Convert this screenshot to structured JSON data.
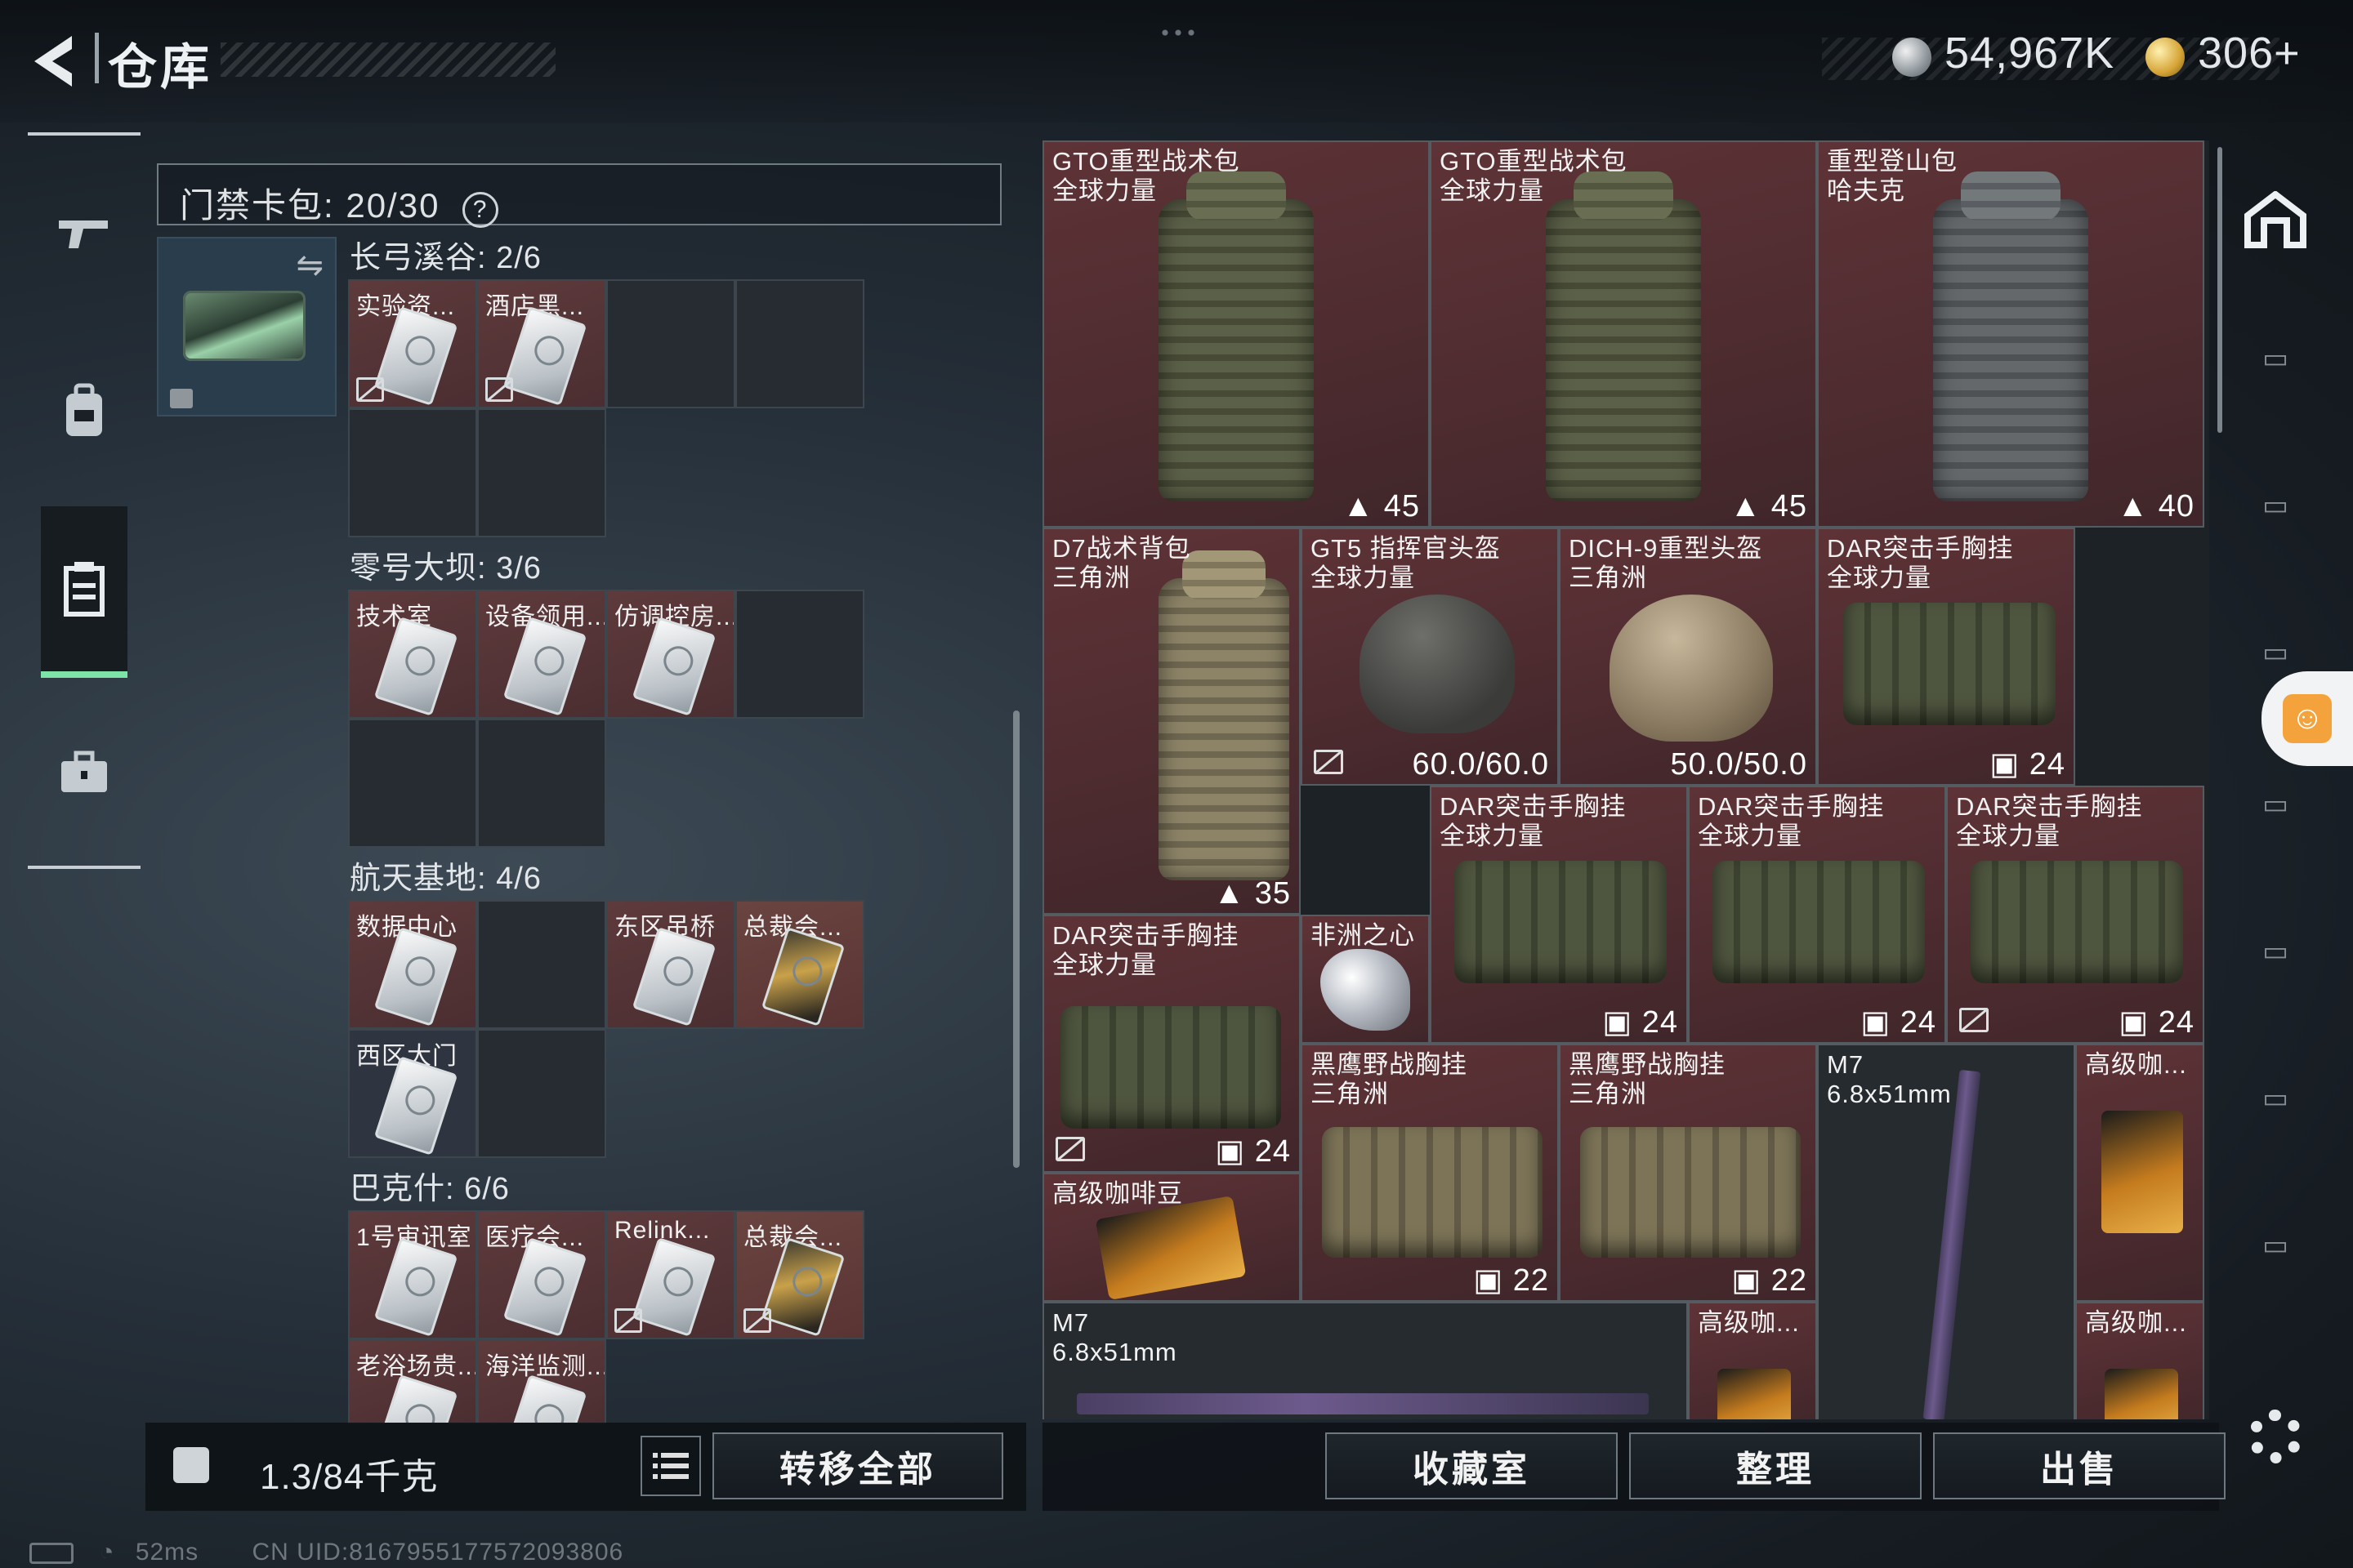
{
  "header": {
    "title": "仓库",
    "currency1": "54,967K",
    "currency2": "306+"
  },
  "access_card_pack": {
    "label": "门禁卡包: 20/30",
    "help": "?"
  },
  "sections": [
    {
      "title": "长弓溪谷: 2/6",
      "slots": [
        {
          "label": "实验资...",
          "locked": true
        },
        {
          "label": "酒店黑...",
          "locked": true
        }
      ]
    },
    {
      "title": "零号大坝: 3/6",
      "slots": [
        {
          "label": "技术室"
        },
        {
          "label": "设备领用..."
        },
        {
          "label": "仿调控房..."
        }
      ]
    },
    {
      "title": "航天基地: 4/6",
      "slots": [
        {
          "label": "数据中心"
        },
        {
          "label": "东区吊桥"
        },
        {
          "label": "总裁会..."
        },
        {
          "label": "西区大门"
        }
      ]
    },
    {
      "title": "巴克什: 6/6",
      "slots": [
        {
          "label": "1号审讯室"
        },
        {
          "label": "医疗会..."
        },
        {
          "label": "Relink..."
        },
        {
          "label": "总裁会..."
        },
        {
          "label": "老浴场贵..."
        },
        {
          "label": "海洋监测..."
        }
      ]
    }
  ],
  "weight": {
    "label": "1.3/84千克",
    "icon": "kg-lock-icon"
  },
  "buttons": {
    "transfer_all": "转移全部",
    "collection": "收藏室",
    "organize": "整理",
    "sell": "出售"
  },
  "items": [
    {
      "name": "GTO重型战术包\n全球力量",
      "count": "45"
    },
    {
      "name": "GTO重型战术包\n全球力量",
      "count": "45"
    },
    {
      "name": "重型登山包\n哈夫克",
      "count": "40"
    },
    {
      "name": "D7战术背包\n三角洲",
      "count": "35"
    },
    {
      "name": "GT5 指挥官头盔\n全球力量",
      "count": "60.0/60.0"
    },
    {
      "name": "DICH-9重型头盔\n三角洲",
      "count": "50.0/50.0"
    },
    {
      "name": "DAR突击手胸挂\n全球力量",
      "count": "24"
    },
    {
      "name": "DAR突击手胸挂\n全球力量",
      "count": "24"
    },
    {
      "name": "DAR突击手胸挂\n全球力量",
      "count": "24"
    },
    {
      "name": "DAR突击手胸挂\n全球力量",
      "count": "24"
    },
    {
      "name": "DAR突击手胸挂\n全球力量",
      "count": "24"
    },
    {
      "name": "非洲之心",
      "count": ""
    },
    {
      "name": "黑鹰野战胸挂\n三角洲",
      "count": "22"
    },
    {
      "name": "黑鹰野战胸挂\n三角洲",
      "count": "22"
    },
    {
      "name": "M7\n6.8x51mm",
      "count": ""
    },
    {
      "name": "高级咖...",
      "count": ""
    },
    {
      "name": "高级咖啡豆",
      "count": ""
    },
    {
      "name": "M7\n6.8x51mm",
      "count": ""
    },
    {
      "name": "高级咖...",
      "count": ""
    },
    {
      "name": "高级咖...",
      "count": ""
    }
  ],
  "status": {
    "ping": "52ms",
    "uid": "CN UID:8167955177572093806"
  }
}
